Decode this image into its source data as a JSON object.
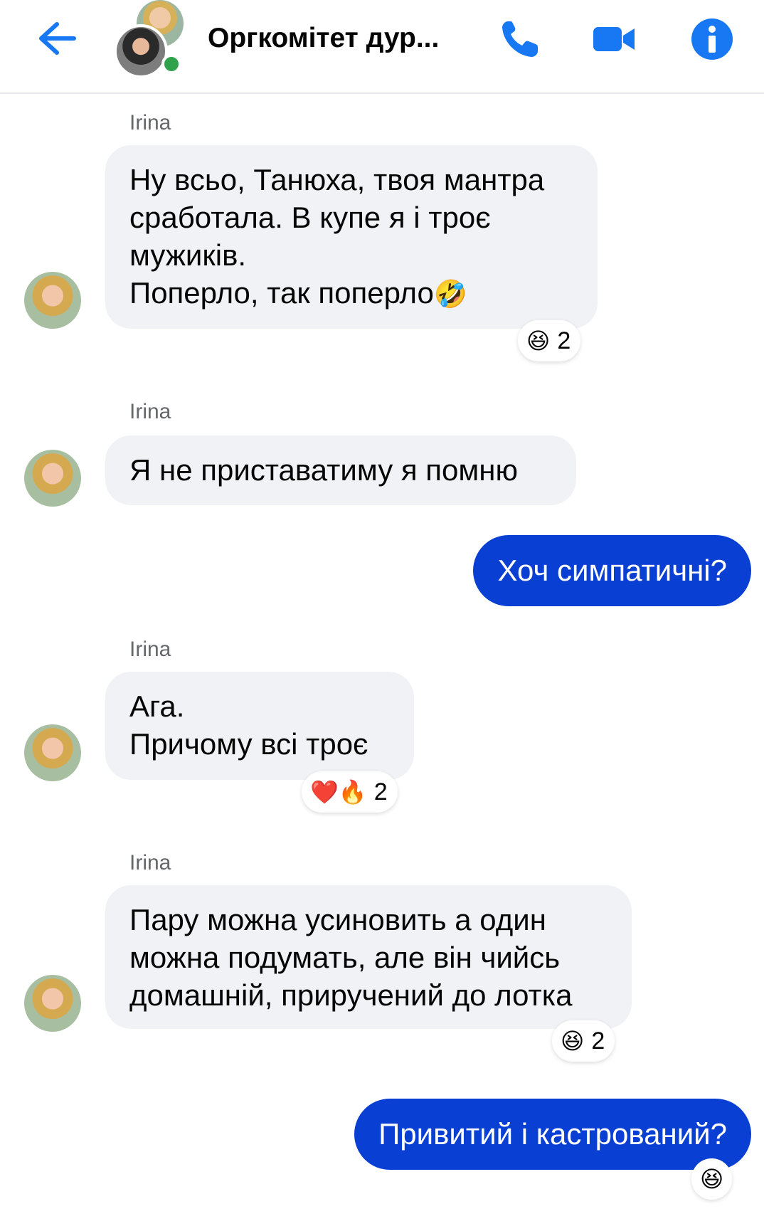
{
  "header": {
    "back_icon": "arrow-left-icon",
    "title": "Оргкомітет дур...",
    "accent": "#1877f2",
    "icons": [
      "phone-icon",
      "video-camera-icon",
      "info-icon"
    ]
  },
  "messages": [
    {
      "sender": "Irina",
      "text": "Ну всьо, Танюха, твоя мантра\nсработала. В купе я і троє\nмужиків.\nПоперло, так поперло",
      "inline_emoji": "🤣",
      "reaction": {
        "emojis": "😆",
        "count": "2"
      }
    },
    {
      "sender": "Irina",
      "text": "Я не приставатиму я помню"
    },
    {
      "outgoing": true,
      "text": "Хоч симпатичні?"
    },
    {
      "sender": "Irina",
      "text": "Ага.\nПричому всі троє",
      "reaction": {
        "emojis": "❤️🔥",
        "count": "2"
      }
    },
    {
      "sender": "Irina",
      "text": "Пару можна усиновить а один\nможна подумать, але він чийсь\nдомашній, приручений до лотка",
      "reaction": {
        "emojis": "😆",
        "count": "2"
      }
    },
    {
      "outgoing": true,
      "text": "Привитий і кастрований?",
      "reaction": {
        "emojis": "😆"
      }
    }
  ],
  "colors": {
    "incoming_bubble": "#f0f2f5",
    "outgoing_bubble": "#0a3fd4",
    "sender_label": "#65676b",
    "online_dot": "#31a24c"
  }
}
